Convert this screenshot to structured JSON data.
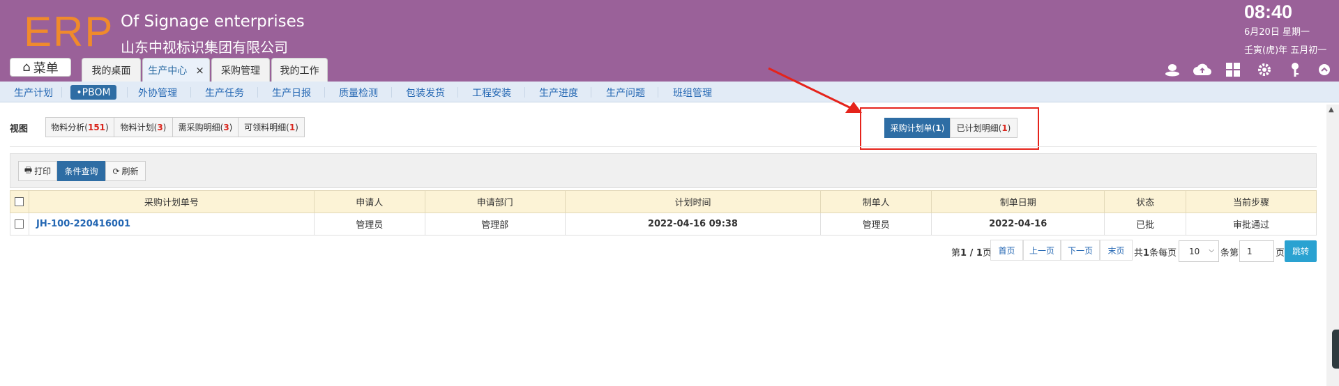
{
  "header": {
    "logo": "ERP",
    "company_en": "Of Signage enterprises",
    "company_cn": "山东中视标识集团有限公司",
    "time": "08:40",
    "date": "6月20日 星期一",
    "lunar": "壬寅(虎)年 五月初一",
    "menu_label": "菜单",
    "tabs": [
      {
        "label": "我的桌面"
      },
      {
        "label": "生产中心",
        "close": "×"
      },
      {
        "label": "采购管理"
      },
      {
        "label": "我的工作"
      }
    ]
  },
  "subnav": {
    "items": [
      "生产计划",
      "•PBOM",
      "外协管理",
      "生产任务",
      "生产日报",
      "质量检测",
      "包装发货",
      "工程安装",
      "生产进度",
      "生产问题",
      "班组管理"
    ]
  },
  "view": {
    "label": "视图",
    "buttons": [
      {
        "label": "物料分析(",
        "count": "151",
        "end": ")"
      },
      {
        "label": "物料计划(",
        "count": "3",
        "end": ")"
      },
      {
        "label": "需采购明细(",
        "count": "3",
        "end": ")"
      },
      {
        "label": "可领料明细(",
        "count": "1",
        "end": ")"
      }
    ],
    "right_buttons": [
      {
        "label": "采购计划单(",
        "count": "1",
        "end": ")"
      },
      {
        "label": "已计划明细(",
        "count": "1",
        "end": ")"
      }
    ]
  },
  "toolbar": {
    "print": "打印",
    "query": "条件查询",
    "refresh": "刷新"
  },
  "table": {
    "headers": [
      "采购计划单号",
      "申请人",
      "申请部门",
      "计划时间",
      "制单人",
      "制单日期",
      "状态",
      "当前步骤"
    ],
    "rows": [
      [
        "JH-100-220416001",
        "管理员",
        "管理部",
        "2022-04-16 09:38",
        "管理员",
        "2022-04-16",
        "已批",
        "审批通过"
      ]
    ]
  },
  "pager": {
    "page_prefix": "第",
    "page_value": "1 / 1",
    "page_suffix": "页",
    "first": "首页",
    "prev": "上一页",
    "next": "下一页",
    "last": "末页",
    "total_prefix": "共",
    "total_value": "1",
    "total_suffix": "条每页",
    "per_page": "10",
    "goto_prefix": "条第",
    "goto_value": "1",
    "goto_suffix": "页",
    "jump": "跳转"
  },
  "colors": {
    "header_bg": "#9a6199",
    "logo": "#f08a2c",
    "primary": "#2e6da4",
    "highlight": "#e5231b",
    "jump": "#2aa2d1"
  }
}
